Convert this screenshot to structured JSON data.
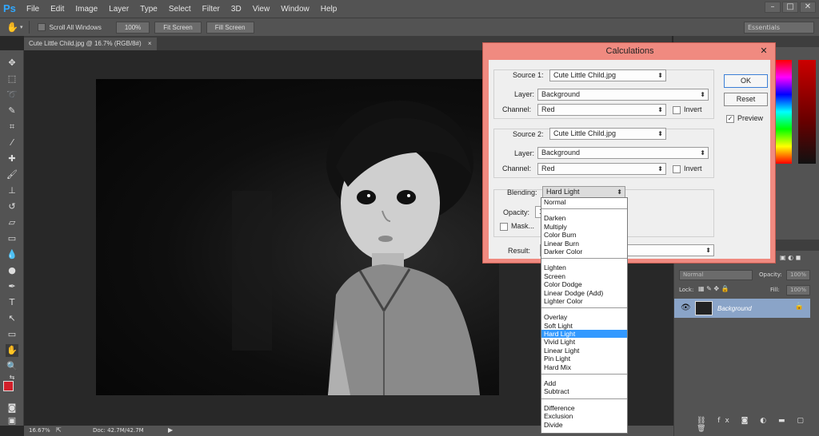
{
  "app": {
    "logo": "Ps"
  },
  "menubar": {
    "items": [
      "File",
      "Edit",
      "Image",
      "Layer",
      "Type",
      "Select",
      "Filter",
      "3D",
      "View",
      "Window",
      "Help"
    ]
  },
  "window_controls": [
    "–",
    "□",
    "✕"
  ],
  "options": {
    "scroll_all": "Scroll All Windows",
    "zoom_100": "100%",
    "fit_screen": "Fit Screen",
    "fill_screen": "Fill Screen",
    "workspace": "Essentials"
  },
  "document": {
    "tab_title": "Cute Little Child.jpg @ 16.7% (RGB/8#)",
    "close": "×"
  },
  "status": {
    "zoom": "16.67%",
    "doc": "Doc: 42.7M/42.7M"
  },
  "layers": {
    "blend_mode": "Normal",
    "opacity_label": "Opacity:",
    "opacity_value": "100%",
    "lock_label": "Lock:",
    "fill_label": "Fill:",
    "fill_value": "100%",
    "layer_name": "Background"
  },
  "dialog": {
    "title": "Calculations",
    "close": "✕",
    "source1_label": "Source 1:",
    "source1_value": "Cute Little Child.jpg",
    "layer1_label": "Layer:",
    "layer1_value": "Background",
    "channel1_label": "Channel:",
    "channel1_value": "Red",
    "invert1_label": "Invert",
    "source2_label": "Source 2:",
    "source2_value": "Cute Little Child.jpg",
    "layer2_label": "Layer:",
    "layer2_value": "Background",
    "channel2_label": "Channel:",
    "channel2_value": "Red",
    "invert2_label": "Invert",
    "blending_label": "Blending:",
    "blending_value": "Hard Light",
    "opacity_label": "Opacity:",
    "opacity_value": "1",
    "mask_label": "Mask...",
    "result_label": "Result:",
    "result_value": "(",
    "ok": "OK",
    "reset": "Reset",
    "preview_label": "Preview"
  },
  "blend_options": [
    [
      "Normal"
    ],
    [
      "Darken",
      "Multiply",
      "Color Burn",
      "Linear Burn",
      "Darker Color"
    ],
    [
      "Lighten",
      "Screen",
      "Color Dodge",
      "Linear Dodge (Add)",
      "Lighter Color"
    ],
    [
      "Overlay",
      "Soft Light",
      "Hard Light",
      "Vivid Light",
      "Linear Light",
      "Pin Light",
      "Hard Mix"
    ],
    [
      "Add",
      "Subtract"
    ],
    [
      "Difference",
      "Exclusion",
      "Divide"
    ]
  ],
  "blend_selected": "Hard Light"
}
